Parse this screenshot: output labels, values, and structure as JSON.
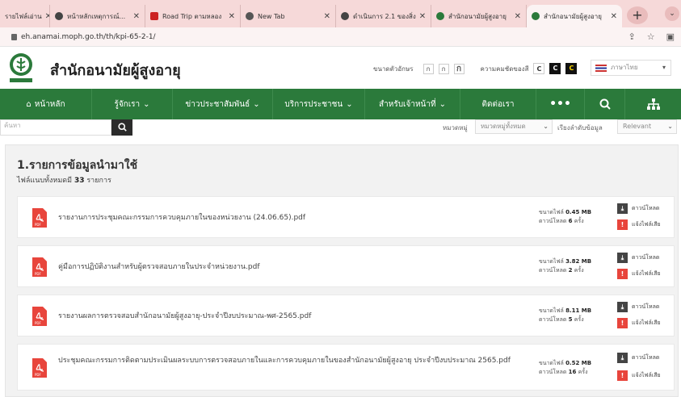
{
  "browser": {
    "tabs": [
      {
        "label": "รายไฟล์เอ่าน",
        "fav": "#6b4fa0"
      },
      {
        "label": "หน้าหลักเหตุการณ์...",
        "fav": "#444444"
      },
      {
        "label": "Road Trip ตามหลอง",
        "fav": "#cc2222"
      },
      {
        "label": "New Tab",
        "fav": "#555555"
      },
      {
        "label": "ดำเนินการ 2.1 ของสิ่ง",
        "fav": "#444444"
      },
      {
        "label": "สำนักอนามัยผู้สูงอายุ",
        "fav": "#2b7a3b"
      },
      {
        "label": "สำนักอนามัยผู้สูงอายุ",
        "fav": "#2b7a3b"
      }
    ],
    "url": "eh.anamai.moph.go.th/th/kpi-65-2-1/"
  },
  "header": {
    "title": "สำนักอนามัยผู้สูงอายุ",
    "font_size_label": "ขนาดตัวอักษร",
    "font_buttons": [
      "ก",
      "ก",
      "ก"
    ],
    "contrast_label": "ความคมชัดของสี",
    "contrast_buttons": [
      "C",
      "C",
      "C"
    ],
    "language": "ภาษาไทย"
  },
  "nav": {
    "home": "หน้าหลัก",
    "about": "รู้จักเรา",
    "news": "ข่าวประชาสัมพันธ์",
    "services": "บริการประชาชน",
    "staff": "สำหรับเจ้าหน้าที่",
    "contact": "ติดต่อเรา",
    "more": "•••"
  },
  "filter": {
    "search_placeholder": "ค้นหา",
    "category_label": "หมวดหมู่",
    "category_value": "หมวดหมู่ทั้งหมด",
    "sort_label": "เรียงลำดับข้อมูล",
    "sort_value": "Relevant"
  },
  "main": {
    "section_title": "1.รายการข้อมูลนำมาใช้",
    "file_count_prefix": "ไฟล์แนบทั้งหมดมี",
    "file_count_value": "33",
    "file_count_suffix": "รายการ",
    "download_label": "ดาวน์โหลด",
    "report_label": "แจ้งไฟล์เสีย",
    "size_label": "ขนาดไฟล์",
    "downloads_label": "ดาวน์โหลด",
    "downloads_unit": "ครั้ง",
    "files": [
      {
        "name": "รายงานการประชุมคณะกรรมการควบคุมภายในของหน่วยงาน (24.06.65).pdf",
        "size": "0.45 MB",
        "downloads": "6"
      },
      {
        "name": "คู่มือการปฏิบัติงานสำหรับผู้ตรวจสอบภายในประจำหน่วยงาน.pdf",
        "size": "3.82 MB",
        "downloads": "2"
      },
      {
        "name": "รายงานผลการตรวจสอบสำนักอนามัยผู้สูงอายุ-ประจำปีงบประมาณ-พศ-2565.pdf",
        "size": "8.11 MB",
        "downloads": "5"
      },
      {
        "name": "ประชุมคณะกรรมการติดตามประเมินผลระบบการตรวจสอบภายในและการควบคุมภายในของสำนักอนามัยผู้สูงอายุ ประจำปีงบประมาณ 2565.pdf",
        "size": "0.52 MB",
        "downloads": "16"
      }
    ]
  },
  "colors": {
    "nav_green": "#2b7a3b",
    "tab_strip": "#f6d9d9",
    "pdf_red": "#e8453c",
    "download_dark": "#444444"
  }
}
